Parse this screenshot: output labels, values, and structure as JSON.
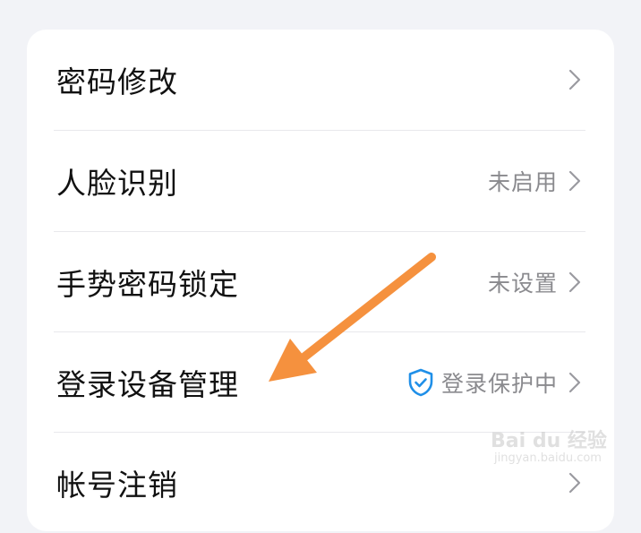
{
  "settings": {
    "items": [
      {
        "label": "密码修改",
        "status": ""
      },
      {
        "label": "人脸识别",
        "status": "未启用"
      },
      {
        "label": "手势密码锁定",
        "status": "未设置"
      },
      {
        "label": "登录设备管理",
        "status": "登录保护中"
      },
      {
        "label": "帐号注销",
        "status": ""
      }
    ]
  },
  "icons": {
    "chevron": "chevron-right-icon",
    "shield": "shield-check-icon"
  },
  "colors": {
    "background": "#f2f3f7",
    "card": "#ffffff",
    "label_text": "#111111",
    "status_text": "#8a8a8e",
    "chevron": "#9a9aa0",
    "shield": "#1f8fe8",
    "annotation_arrow": "#f5913e"
  },
  "watermark": {
    "brand": "Bai du 经验",
    "url": "jingyan.baidu.com"
  }
}
